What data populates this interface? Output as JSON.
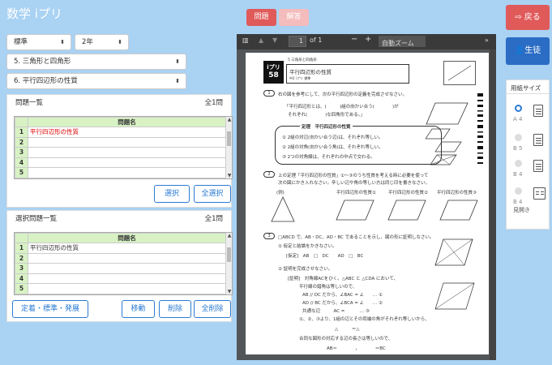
{
  "app_title": "数学 iプリ",
  "tabs": {
    "question": "問題",
    "answer": "解答"
  },
  "filters": {
    "level": "標準",
    "grade": "2年",
    "unit": "5. 三角形と四角形",
    "subunit": "6. 平行四辺形の性質"
  },
  "problem_list": {
    "title": "問題一覧",
    "count": "全1問",
    "column": "問題名",
    "rows": [
      {
        "no": "1",
        "name": "平行四辺形の性質"
      },
      {
        "no": "2",
        "name": ""
      },
      {
        "no": "3",
        "name": ""
      },
      {
        "no": "4",
        "name": ""
      },
      {
        "no": "5",
        "name": ""
      }
    ],
    "buttons": {
      "select": "選択",
      "select_all": "全選択"
    }
  },
  "selected_list": {
    "title": "選択問題一覧",
    "count": "全1問",
    "column": "問題名",
    "rows": [
      {
        "no": "1",
        "name": "平行四辺形の性質"
      },
      {
        "no": "2",
        "name": ""
      },
      {
        "no": "3",
        "name": ""
      },
      {
        "no": "4",
        "name": ""
      },
      {
        "no": "5",
        "name": ""
      }
    ],
    "buttons": {
      "preset": "定着・標準・発展",
      "move": "移動",
      "delete": "削除",
      "delete_all": "全削除"
    }
  },
  "pdf_viewer": {
    "page": "1",
    "of_pages": "of 1",
    "zoom": "自動ズーム",
    "minus": "−",
    "plus": "+",
    "document": {
      "logo": "iプリ",
      "logo_num": "58",
      "header_small": "5 三角形と四角形",
      "title": "平行四辺形の性質",
      "sub": "中2 iプリ 標準",
      "q1": "右の図を参考にして、次の平行四辺形の定義を完成させなさい。",
      "q1_a": "「平行四辺形とは、(　　　)組の向かい合う(　　　　)が",
      "q1_b": "それぞれ(　　　　)な四角形である。」",
      "box_title": "定理　平行四辺形の性質",
      "box_1": "① 2組の対辺(向かい合う辺)は、それぞれ等しい。",
      "box_2": "② 2組の対角(向かい合う角)は、それぞれ等しい。",
      "box_3": "③ 2つの対角線は、それぞれの中点で交わる。",
      "q2": "上の定理「平行四辺形の性質」①〜③のうち性質を考える時に必要を使って",
      "q2_b": "次の図にかき入れなさい。辛しい辺や角の等しい方は同じ印を書きなさい。",
      "q2_labels": [
        "(例)",
        "平行四辺形の性質①",
        "平行四辺形の性質②",
        "平行四辺形の性質③"
      ],
      "q3": "□ABCD で、AB・DC、AD・BC であることを示し、図の形に証明しなさい。",
      "q3_a": "① 仮定と結論をかきなさい。",
      "q3_b": "[仮定]　AB　□　DC　　AD　□　BC",
      "q3_c": "② 証明を完成させなさい。",
      "proof_1": "[証明]　対角線ACをひく。△ABC と △CDA において、",
      "proof_2": "平行線の錯角は等しいので、",
      "proof_3": "AB // DC だから、∠BAC = ∠　　… ①",
      "proof_4": "AD // BC だから、∠BCA = ∠　　… ②",
      "proof_5": "共通な辺　　　AC = 　　　… ③",
      "proof_6": "①、②、③より、1組の辺とその両端の角がそれぞれ等しいから、",
      "proof_7": "△　　　＝△",
      "proof_8": "合同な図形の対応する辺の長さは等しいので、",
      "proof_9": "AB＝　　　　，　　　　＝BC"
    }
  },
  "right_panel": {
    "back_button": "戻る",
    "student_button": "生徒",
    "paper_size_title": "用紙サイズ",
    "options": [
      "A 4",
      "B 5",
      "B 4",
      "B 4"
    ],
    "option_extra": "見開き"
  },
  "colors": {
    "back_button": "#e05a5a",
    "student_button": "#2b6cc4",
    "tab_active": "#e05a5a",
    "accent": "#2b7bd3",
    "background": "#a9d2f3"
  }
}
